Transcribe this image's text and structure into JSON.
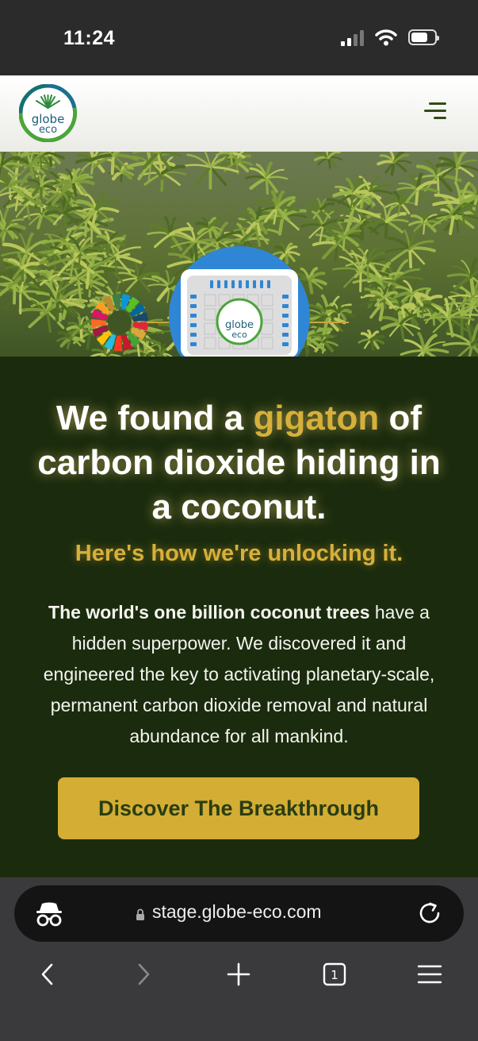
{
  "status_bar": {
    "time": "11:24"
  },
  "site": {
    "logo_text_line1": "globe",
    "logo_text_line2": "eco",
    "chip_logo_line1": "globe",
    "chip_logo_line2": "eco"
  },
  "content": {
    "headline_part1": "We found a ",
    "headline_accent": "gigaton",
    "headline_part2": " of carbon dioxide hiding in a coconut.",
    "subhead": "Here's how we're unlocking it.",
    "body_bold": "The world's one billion coconut trees",
    "body_rest": " have a hidden superpower. We discovered it and engineered the key to activating planetary-scale, permanent carbon dioxide removal and natural abundance for all mankind.",
    "cta_label": "Discover The Breakthrough"
  },
  "browser": {
    "url": "stage.globe-eco.com",
    "tab_count": "1"
  },
  "colors": {
    "background": "#1b2c0e",
    "accent": "#d7b03a",
    "button": "#d4ad35",
    "button_text": "#2a3d11"
  },
  "icons": {
    "signal": "signal-icon",
    "wifi": "wifi-icon",
    "battery": "battery-icon",
    "menu": "hamburger-menu-icon",
    "incognito": "incognito-icon",
    "lock": "lock-icon",
    "reload": "reload-icon",
    "back": "back-arrow-icon",
    "forward": "forward-arrow-icon",
    "new_tab": "plus-icon",
    "tabs": "tabs-icon",
    "browser_menu": "menu-icon"
  }
}
